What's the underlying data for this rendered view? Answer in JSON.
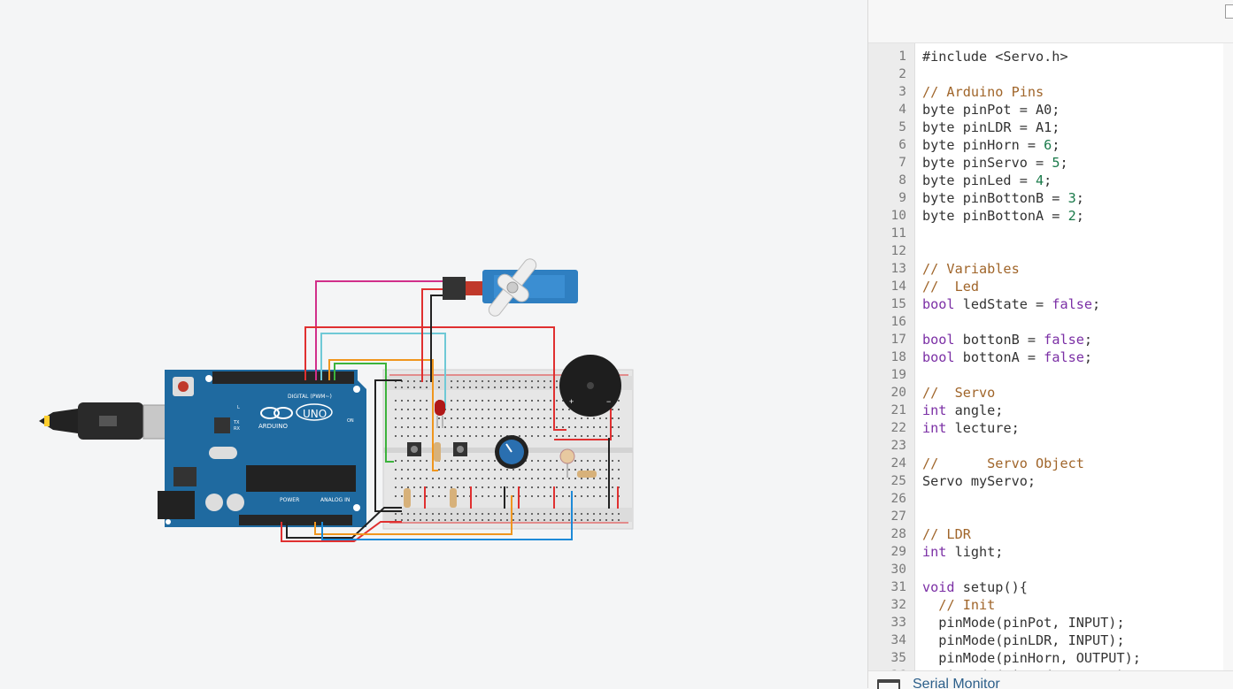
{
  "window": {
    "panel": "code-editor",
    "status_bar": {
      "serial_monitor_label": "Serial Monitor"
    }
  },
  "circuit": {
    "board_labels": {
      "brand": "ARDUINO",
      "model": "UNO",
      "digital_header": "DIGITAL (PWM~)",
      "power_header": "POWER",
      "analog_header": "ANALOG IN",
      "tx": "TX",
      "rx": "RX",
      "led_l": "L",
      "on": "ON"
    },
    "components": [
      "arduino-uno",
      "breadboard",
      "servo",
      "piezo-buzzer",
      "potentiometer",
      "photoresistor",
      "red-led",
      "push-button",
      "push-button",
      "resistor",
      "resistor",
      "resistor",
      "resistor"
    ]
  },
  "code": {
    "lines": [
      "#include <Servo.h>",
      "",
      "// Arduino Pins",
      "byte pinPot = A0;",
      "byte pinLDR = A1;",
      "byte pinHorn = 6;",
      "byte pinServo = 5;",
      "byte pinLed = 4;",
      "byte pinBottonB = 3;",
      "byte pinBottonA = 2;",
      "",
      "",
      "// Variables",
      "//  Led",
      "bool ledState = false;",
      "",
      "bool bottonB = false;",
      "bool bottonA = false;",
      "",
      "//  Servo",
      "int angle;",
      "int lecture;",
      "",
      "//      Servo Object",
      "Servo myServo;",
      "",
      "",
      "// LDR",
      "int light;",
      "",
      "void setup(){",
      "  // Init",
      "  pinMode(pinPot, INPUT);",
      "  pinMode(pinLDR, INPUT);",
      "  pinMode(pinHorn, OUTPUT);",
      "  pinMode(pinLed, OUTPUT);"
    ]
  }
}
